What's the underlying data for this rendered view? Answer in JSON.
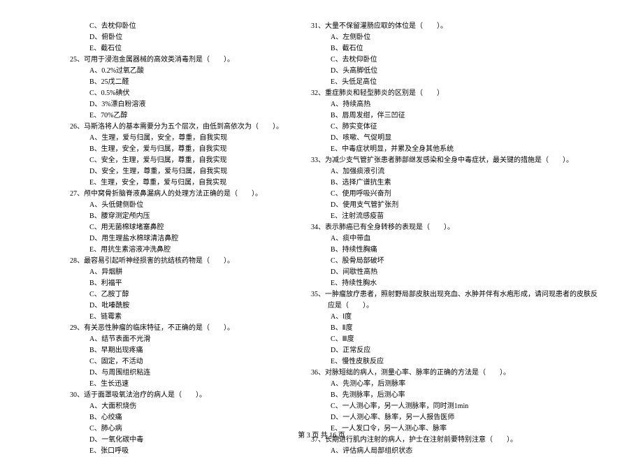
{
  "leftColumn": {
    "pre_options": [
      "C、去枕仰卧位",
      "D、俯卧位",
      "E、截石位"
    ],
    "questions": [
      {
        "num": "25、",
        "stem": "可用于浸泡金属器械的高效类消毒剂是（　　）。",
        "options": [
          "A、0.2%过氧乙酸",
          "B、25戊二醛",
          "C、0.5%碘伏",
          "D、3%漂白粉溶液",
          "E、70%乙醇"
        ]
      },
      {
        "num": "26、",
        "stem": "马斯洛将人的基本需要分为五个层次，由低到高依次为（　　）。",
        "options": [
          "A、生理，爱与归属，安全，尊重，自我实现",
          "B、生理，安全，爱与归属，尊重，自我实现",
          "C、安全，生理，爱与归属，尊重，自我实现",
          "D、安全，生理，尊重，爱与归属，自我实现",
          "E、生理，安全，尊重，爱与归属，自我实现"
        ]
      },
      {
        "num": "27、",
        "stem": "颅中窝骨折脑脊液鼻漏病人的处理方法正确的是（　　）。",
        "options": [
          "A、头低健侧卧位",
          "B、腰穿测定颅内压",
          "C、用无菌棉球堵塞鼻腔",
          "D、用生理盐水棉球清洁鼻腔",
          "E、用抗生素溶液冲洗鼻腔"
        ]
      },
      {
        "num": "28、",
        "stem": "最容易引起听神经损害的抗结核药物是（　　）。",
        "options": [
          "A、异烟肼",
          "B、利福平",
          "C、乙胺丁醇",
          "D、吡嗪酰胺",
          "E、链霉素"
        ]
      },
      {
        "num": "29、",
        "stem": "有关恶性肿瘤的临床特征，不正确的是（　　）。",
        "options": [
          "A、结节表面不光滑",
          "B、早期出现疼痛",
          "C、固定，不活动",
          "D、与周围组织粘连",
          "E、生长迅速"
        ]
      },
      {
        "num": "30、",
        "stem": "适于面罩吸氧法治疗的病人是（　　）。",
        "options": [
          "A、大面积烧伤",
          "B、心绞痛",
          "C、肺心病",
          "D、一氧化碳中毒",
          "E、张口呼吸"
        ]
      }
    ]
  },
  "rightColumn": {
    "questions": [
      {
        "num": "31、",
        "stem": "大量不保留灌肠应取的体位是（　　）。",
        "options": [
          "A、左侧卧位",
          "B、截石位",
          "C、去枕仰卧位",
          "D、头高脚低位",
          "E、头低足高位"
        ]
      },
      {
        "num": "32、",
        "stem": "重症肺炎和轻型肺炎的区别是（　　）",
        "options": [
          "A、持续高热",
          "B、唇周发绀，伴三凹征",
          "C、肺实变体征",
          "D、咳嗽、气促明显",
          "E、中毒症状明显，并累及全身其他系统"
        ]
      },
      {
        "num": "33、",
        "stem": "为减少支气管扩张患者肺部继发感染和全身中毒症状，最关键的措施是（　　）。",
        "options": [
          "A、加强痰液引流",
          "B、选择广谱抗生素",
          "C、使用呼吸兴奋剂",
          "D、使用支气管扩张剂",
          "E、注射流感疫苗"
        ]
      },
      {
        "num": "34、",
        "stem": "表示肺癌已有全身转移的表现是（　　）。",
        "options": [
          "A、痰中带血",
          "B、持续性胸痛",
          "C、股骨局部破坏",
          "D、间歇性高热",
          "E、持续性胸水"
        ]
      },
      {
        "num": "35、",
        "stem_lines": [
          "一肿瘤放疗患者，照射野局部皮肤出现充血、水肿并伴有水疱形成，请问现患者的皮肤反",
          "应是（　　）。"
        ],
        "options": [
          "A、Ⅰ度",
          "B、Ⅱ度",
          "C、Ⅲ度",
          "D、正常反应",
          "E、慢性皮肤反应"
        ]
      },
      {
        "num": "36、",
        "stem": "对脉短绌的病人，测量心率、脉率的正确的方法是（　　）。",
        "options": [
          "A、先测心率，后测脉率",
          "B、先测脉率，后测心率",
          "C、一人测心率，另一人测脉率，同时测1min",
          "D、一人测心率、脉率，另一人报告医师",
          "E、一人发口令，另一人测心率、脉率"
        ]
      },
      {
        "num": "37、",
        "stem": "长期进行肌内注射的病人，护士在注射前要特别注意（　　）。",
        "options": [
          "A、评估病人局部组织状态"
        ]
      }
    ]
  },
  "footer": "第 3 页 共 16 页"
}
